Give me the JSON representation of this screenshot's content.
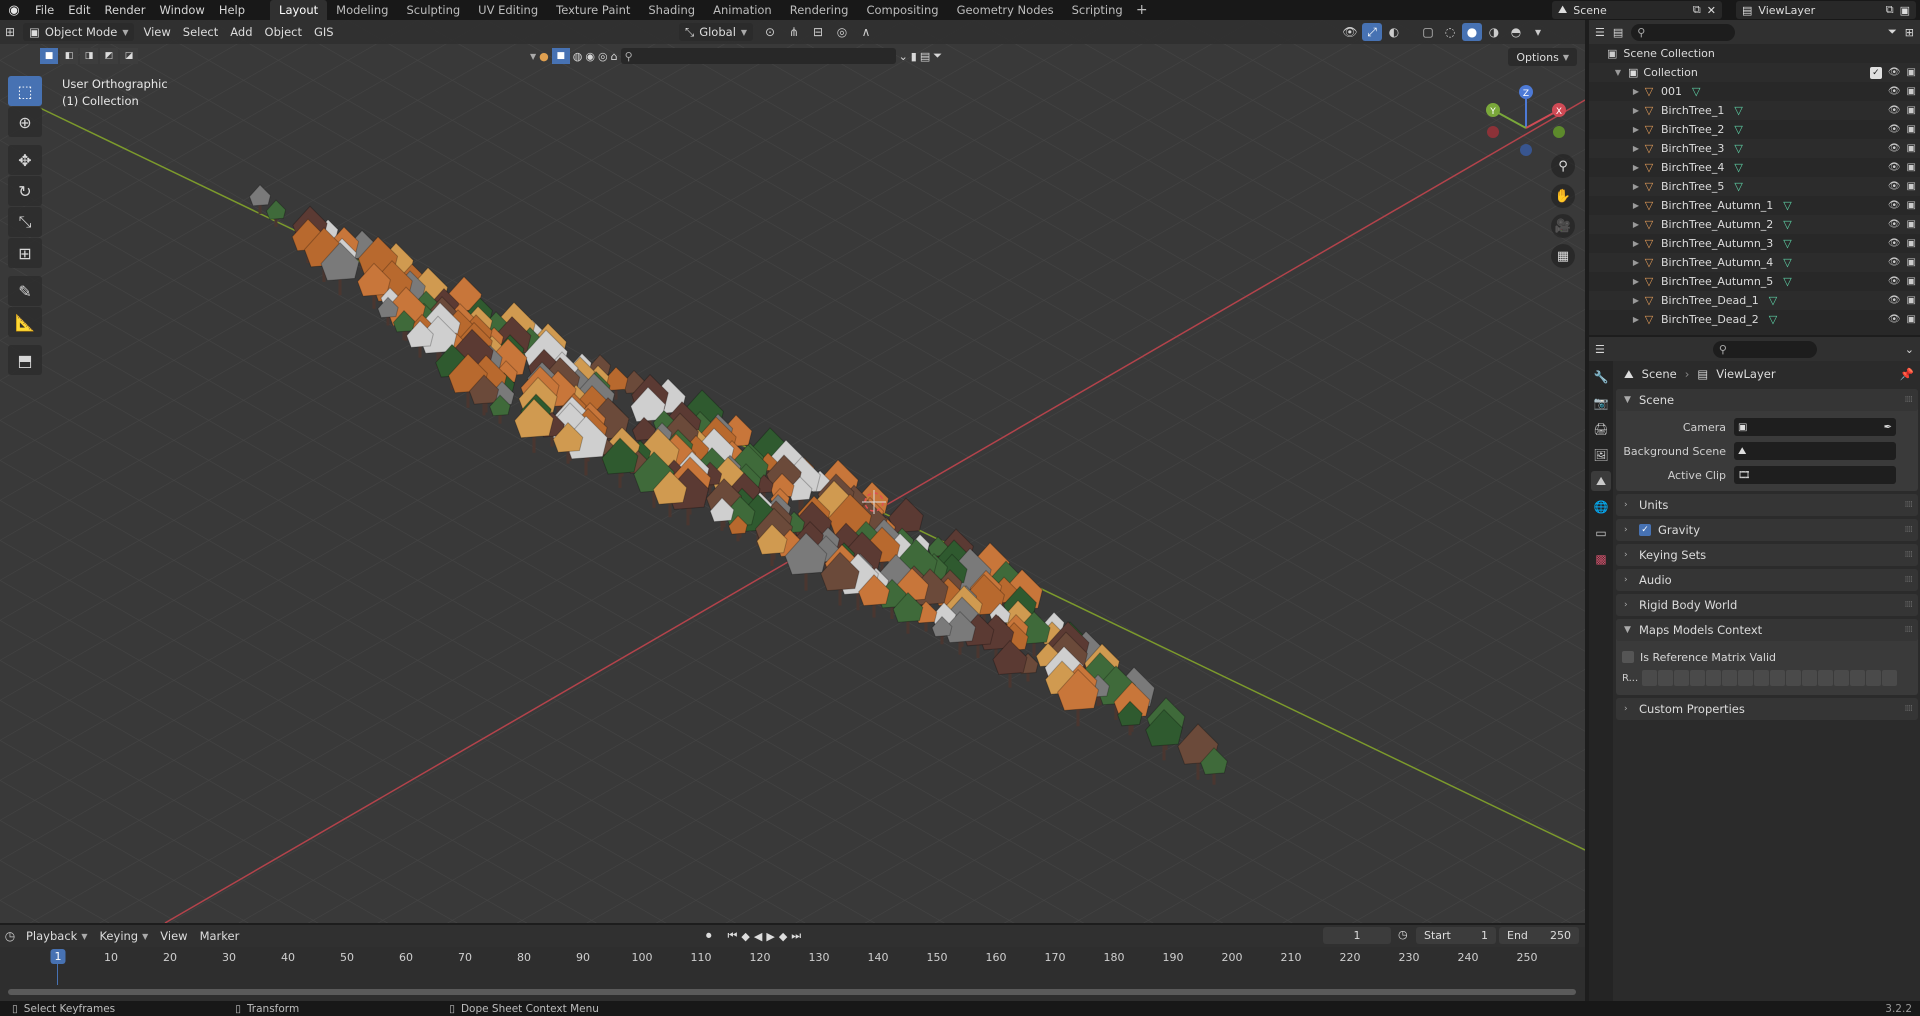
{
  "menu": {
    "items": [
      "File",
      "Edit",
      "Render",
      "Window",
      "Help"
    ],
    "workspaces": [
      "Layout",
      "Modeling",
      "Sculpting",
      "UV Editing",
      "Texture Paint",
      "Shading",
      "Animation",
      "Rendering",
      "Compositing",
      "Geometry Nodes",
      "Scripting"
    ],
    "active_workspace": "Layout",
    "scene_name": "Scene",
    "view_layer_name": "ViewLayer"
  },
  "viewport": {
    "mode": "Object Mode",
    "menus": [
      "View",
      "Select",
      "Add",
      "Object",
      "GIS"
    ],
    "orientation": "Global",
    "options_label": "Options",
    "view_name": "User Orthographic",
    "collection_label": "(1) Collection"
  },
  "outliner": {
    "root": "Scene Collection",
    "collection": "Collection",
    "items": [
      "001",
      "BirchTree_1",
      "BirchTree_2",
      "BirchTree_3",
      "BirchTree_4",
      "BirchTree_5",
      "BirchTree_Autumn_1",
      "BirchTree_Autumn_2",
      "BirchTree_Autumn_3",
      "BirchTree_Autumn_4",
      "BirchTree_Autumn_5",
      "BirchTree_Dead_1",
      "BirchTree_Dead_2"
    ]
  },
  "properties": {
    "breadcrumb_scene": "Scene",
    "breadcrumb_layer": "ViewLayer",
    "scene_panel": "Scene",
    "camera_label": "Camera",
    "background_label": "Background Scene",
    "active_clip_label": "Active Clip",
    "units": "Units",
    "gravity": "Gravity",
    "keying_sets": "Keying Sets",
    "audio": "Audio",
    "rigid_body": "Rigid Body World",
    "maps_context": "Maps Models Context",
    "ref_matrix": "Is Reference Matrix Valid",
    "r_label": "R...",
    "custom_props": "Custom Properties"
  },
  "timeline": {
    "menus": [
      "Playback",
      "Keying",
      "View",
      "Marker"
    ],
    "current_frame": "1",
    "start_label": "Start",
    "start": "1",
    "end_label": "End",
    "end": "250",
    "ticks": [
      "10",
      "20",
      "30",
      "40",
      "50",
      "60",
      "70",
      "80",
      "90",
      "100",
      "110",
      "120",
      "130",
      "140",
      "150",
      "160",
      "170",
      "180",
      "190",
      "200",
      "210",
      "220",
      "230",
      "240",
      "250"
    ]
  },
  "status": {
    "left": "Select Keyframes",
    "middle": "Transform",
    "right": "Dope Sheet Context Menu",
    "version": "3.2.2"
  },
  "colors": {
    "accent": "#4772b3",
    "x_axis": "#b3434b",
    "y_axis": "#7c9a2c",
    "autumn": "#c8763a",
    "pine": "#3f6a3a"
  }
}
